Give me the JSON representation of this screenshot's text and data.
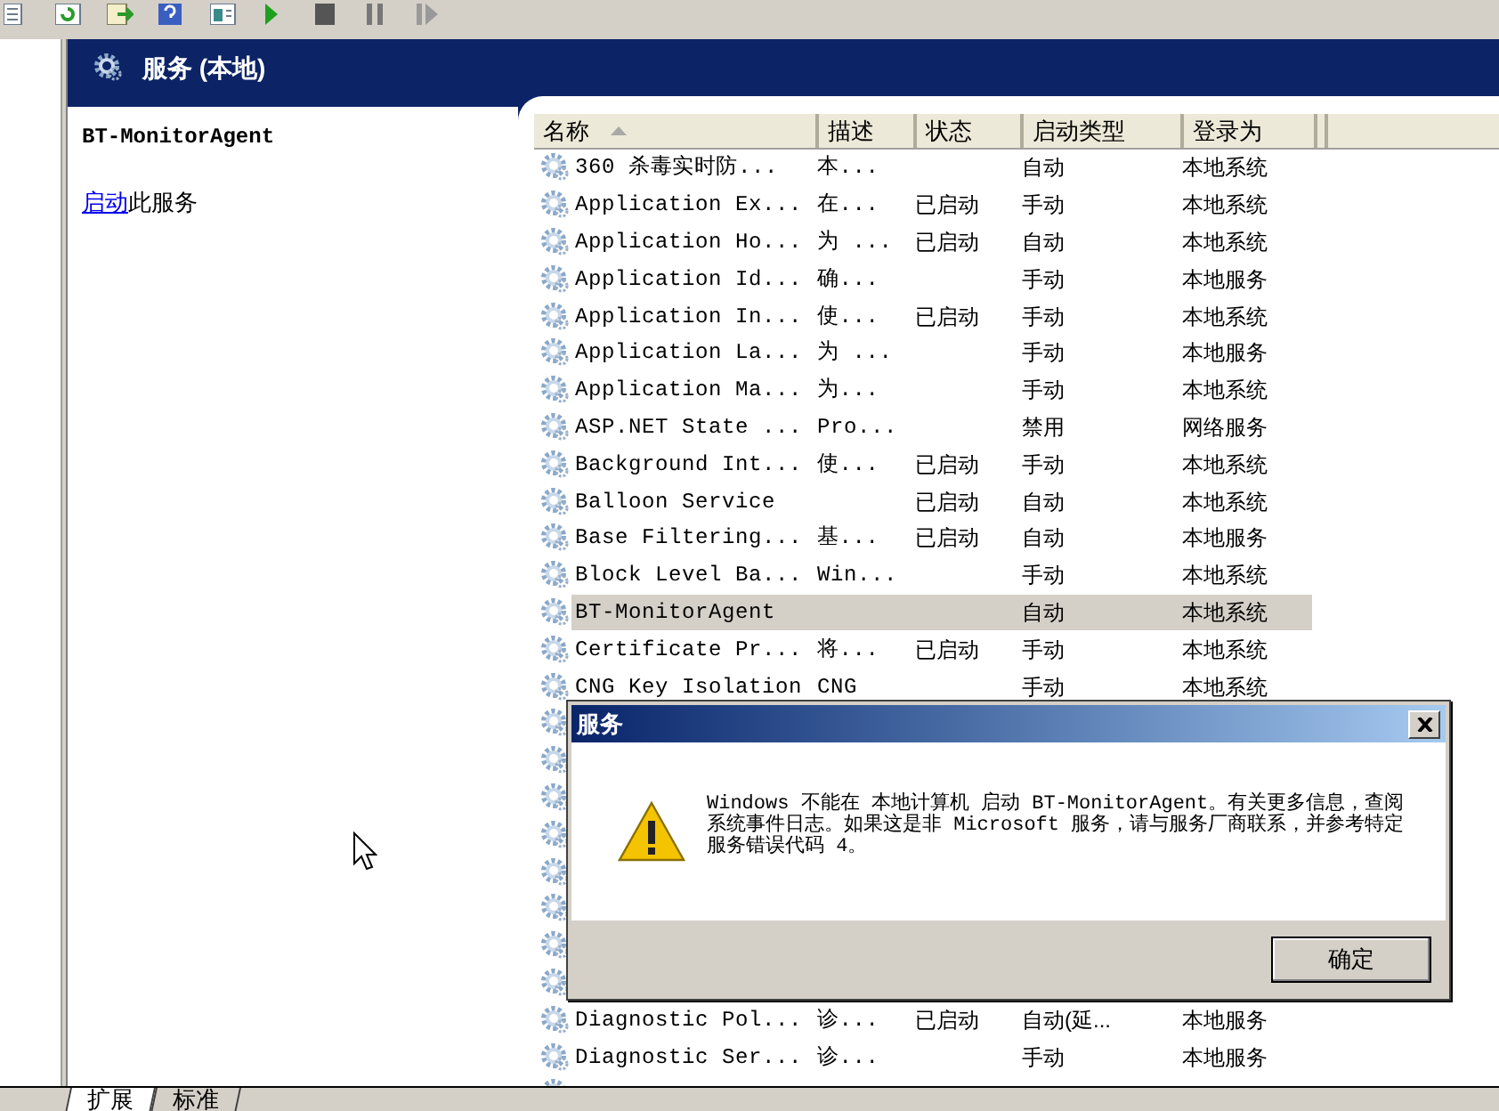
{
  "header": {
    "title": "服务 (本地)"
  },
  "detail": {
    "service_name": "BT-MonitorAgent",
    "action_link": "启动",
    "action_text": "此服务"
  },
  "table": {
    "columns": [
      {
        "label": "名称",
        "sorted": true
      },
      {
        "label": "描述",
        "sorted": false
      },
      {
        "label": "状态",
        "sorted": false
      },
      {
        "label": "启动类型",
        "sorted": false
      },
      {
        "label": "登录为",
        "sorted": false
      }
    ],
    "rows": [
      {
        "kind": "row",
        "selected": false,
        "cells": [
          "360 杀毒实时防...",
          "本...",
          "",
          "自动",
          "本地系统"
        ]
      },
      {
        "kind": "row",
        "selected": false,
        "cells": [
          "Application Ex...",
          "在...",
          "已启动",
          "手动",
          "本地系统"
        ]
      },
      {
        "kind": "row",
        "selected": false,
        "cells": [
          "Application Ho...",
          "为 ...",
          "已启动",
          "自动",
          "本地系统"
        ]
      },
      {
        "kind": "row",
        "selected": false,
        "cells": [
          "Application Id...",
          "确...",
          "",
          "手动",
          "本地服务"
        ]
      },
      {
        "kind": "row",
        "selected": false,
        "cells": [
          "Application In...",
          "使...",
          "已启动",
          "手动",
          "本地系统"
        ]
      },
      {
        "kind": "row",
        "selected": false,
        "cells": [
          "Application La...",
          "为 ...",
          "",
          "手动",
          "本地服务"
        ]
      },
      {
        "kind": "row",
        "selected": false,
        "cells": [
          "Application Ma...",
          "为...",
          "",
          "手动",
          "本地系统"
        ]
      },
      {
        "kind": "row",
        "selected": false,
        "cells": [
          "ASP.NET State ...",
          "Pro...",
          "",
          "禁用",
          "网络服务"
        ]
      },
      {
        "kind": "row",
        "selected": false,
        "cells": [
          "Background Int...",
          "使...",
          "已启动",
          "手动",
          "本地系统"
        ]
      },
      {
        "kind": "row",
        "selected": false,
        "cells": [
          "Balloon Service",
          "",
          "已启动",
          "自动",
          "本地系统"
        ]
      },
      {
        "kind": "row",
        "selected": false,
        "cells": [
          "Base Filtering...",
          "基...",
          "已启动",
          "自动",
          "本地服务"
        ]
      },
      {
        "kind": "row",
        "selected": false,
        "cells": [
          "Block Level Ba...",
          "Win...",
          "",
          "手动",
          "本地系统"
        ]
      },
      {
        "kind": "row",
        "selected": true,
        "cells": [
          "BT-MonitorAgent",
          "",
          "",
          "自动",
          "本地系统"
        ]
      },
      {
        "kind": "row",
        "selected": false,
        "cells": [
          "Certificate Pr...",
          "将...",
          "已启动",
          "手动",
          "本地系统"
        ]
      },
      {
        "kind": "row",
        "selected": false,
        "cells": [
          "CNG Key Isolation",
          "CNG",
          "",
          "手动",
          "本地系统"
        ]
      },
      {
        "kind": "covered"
      },
      {
        "kind": "covered"
      },
      {
        "kind": "covered"
      },
      {
        "kind": "covered"
      },
      {
        "kind": "covered"
      },
      {
        "kind": "covered"
      },
      {
        "kind": "covered"
      },
      {
        "kind": "covered"
      },
      {
        "kind": "row",
        "selected": false,
        "cells": [
          "Diagnostic Pol...",
          "诊...",
          "已启动",
          "自动(延...",
          "本地服务"
        ]
      },
      {
        "kind": "row",
        "selected": false,
        "cells": [
          "Diagnostic Ser...",
          "诊...",
          "",
          "手动",
          "本地服务"
        ]
      },
      {
        "kind": "covered"
      }
    ]
  },
  "dialog": {
    "title": "服务",
    "message": "Windows 不能在 本地计算机 启动 BT-MonitorAgent。有关更多信息，查阅系统事件日志。如果这是非 Microsoft 服务，请与服务厂商联系，并参考特定服务错误代码 4。",
    "button": "确定"
  },
  "bottom_tabs": [
    {
      "label": "扩展",
      "selected": true
    },
    {
      "label": "标准",
      "selected": false
    }
  ]
}
